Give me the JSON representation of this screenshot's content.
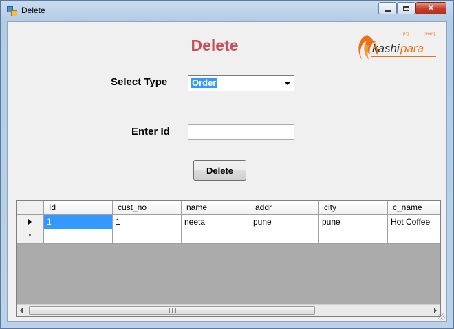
{
  "window": {
    "title": "Delete",
    "close_glyph": "✕"
  },
  "form": {
    "heading": "Delete",
    "select_type_label": "Select Type",
    "select_type_value": "Order",
    "enter_id_label": "Enter Id",
    "enter_id_value": "",
    "delete_button": "Delete"
  },
  "logo": {
    "text_part1": "kashi",
    "text_part2": "para",
    "small_left": "[ि]",
    "small_right": "[संस्कार]"
  },
  "grid": {
    "columns": [
      "Id",
      "cust_no",
      "name",
      "addr",
      "city",
      "c_name"
    ],
    "rows": [
      [
        "1",
        "1",
        "neeta",
        "pune",
        "pune",
        "Hot Coffee"
      ]
    ],
    "new_row_glyph": "*",
    "scroll_grip": "III"
  },
  "colors": {
    "heading": "#c9505a",
    "logo_orange": "#e8731a",
    "selection": "#3399ff"
  },
  "icons": {
    "app": "app-window-icon",
    "row_pointer": "row-pointer-icon",
    "new_row": "new-row-icon"
  }
}
